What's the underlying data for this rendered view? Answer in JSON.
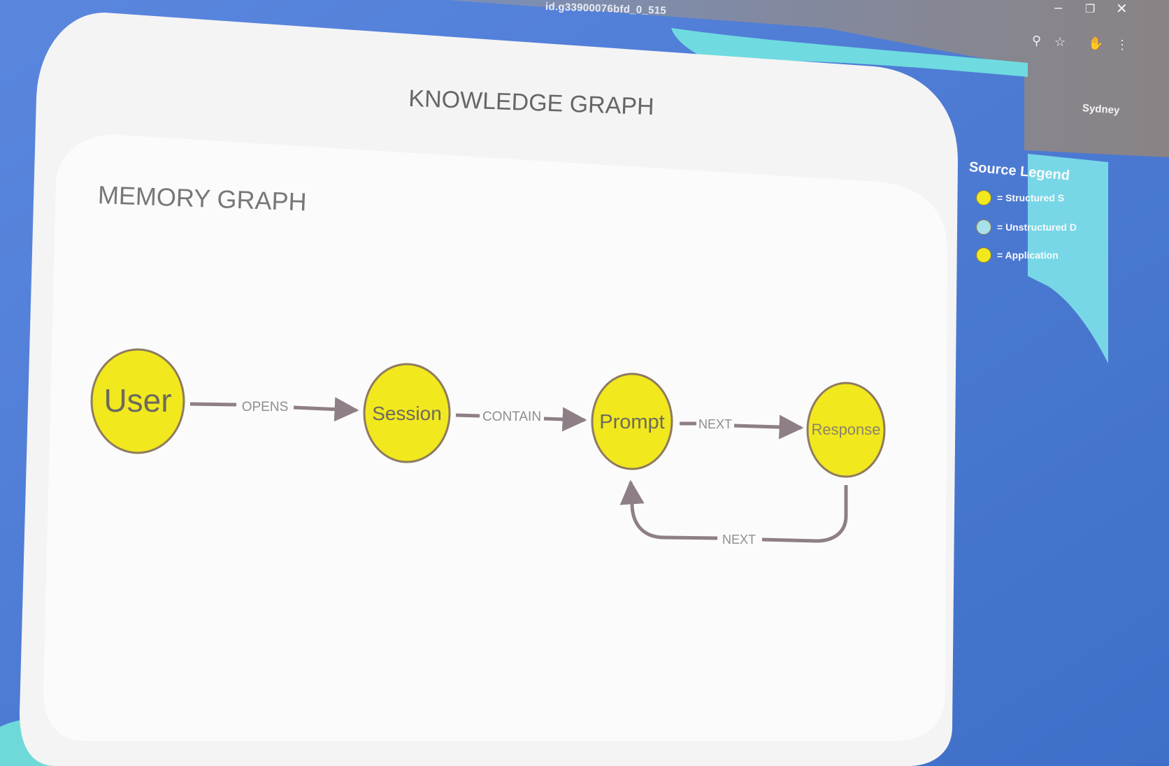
{
  "browser": {
    "url_fragment": "id.g33900076bfd_0_515",
    "minimize_icon": "minimize-icon",
    "restore_icon": "restore-icon",
    "close_icon": "close-icon",
    "profile_name": "Sydney"
  },
  "slide": {
    "title": "KNOWLEDGE GRAPH",
    "section_title": "MEMORY GRAPH"
  },
  "legend": {
    "title": "Source Legend",
    "items": [
      {
        "label": "= Structured S",
        "color": "#f1e81e"
      },
      {
        "label": "= Unstructured D",
        "color": "#a8e0ec"
      },
      {
        "label": "= Application",
        "color": "#f1e81e"
      }
    ]
  },
  "graph": {
    "node_color": "#f1e81e",
    "node_border": "#8e7b5f",
    "edge_color": "#8e7f86",
    "nodes": [
      {
        "id": "user",
        "label": "User"
      },
      {
        "id": "session",
        "label": "Session"
      },
      {
        "id": "prompt",
        "label": "Prompt"
      },
      {
        "id": "response",
        "label": "Response"
      }
    ],
    "edges": [
      {
        "from": "user",
        "to": "session",
        "label": "OPENS"
      },
      {
        "from": "session",
        "to": "prompt",
        "label": "CONTAIN"
      },
      {
        "from": "prompt",
        "to": "response",
        "label": "NEXT"
      },
      {
        "from": "response",
        "to": "prompt",
        "label": "NEXT"
      }
    ]
  }
}
